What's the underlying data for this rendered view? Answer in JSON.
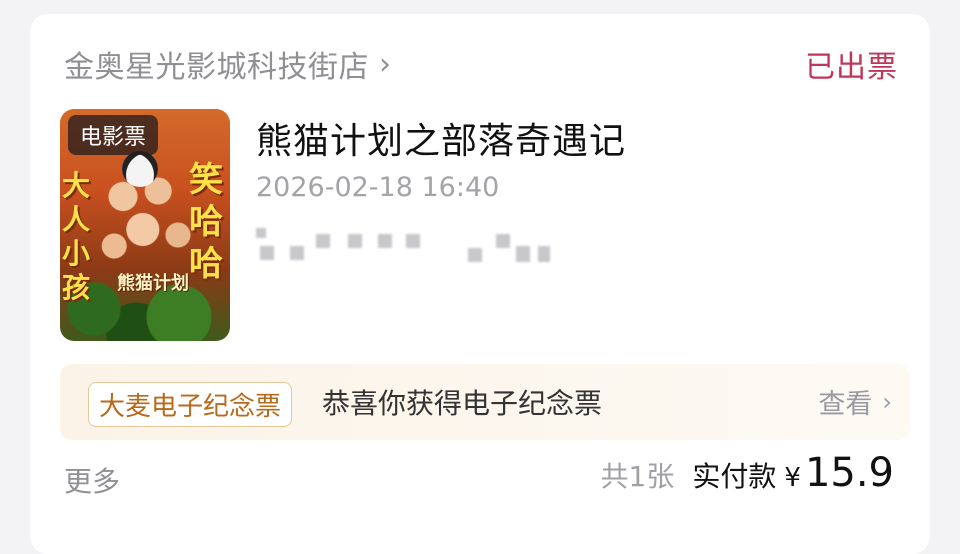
{
  "store": {
    "name": "金奥星光影城科技街店",
    "chevron": "›"
  },
  "order": {
    "status": "已出票"
  },
  "poster": {
    "tag": "电影票",
    "art_left_text": "大人小孩",
    "art_right_text": "笑哈哈",
    "art_logo_text": "熊猫计划"
  },
  "movie": {
    "title": "熊猫计划之部落奇遇记",
    "showtime": "2026-02-18 16:40"
  },
  "banner": {
    "badge": "大麦电子纪念票",
    "message": "恭喜你获得电子纪念票",
    "view_label": "查看",
    "chevron": "›"
  },
  "footer": {
    "more_label": "更多",
    "ticket_count": "共1张",
    "paid_label": "实付款",
    "currency": "¥",
    "amount": "15.9"
  },
  "colors": {
    "status": "#c0365a",
    "badge_text": "#b86a1c",
    "badge_border": "#e5c79a",
    "banner_bg": "#fbf3e7",
    "page_bg": "#f3f3f5"
  },
  "icons": {
    "store_chevron": "chevron-right-icon",
    "view_chevron": "chevron-right-icon"
  }
}
